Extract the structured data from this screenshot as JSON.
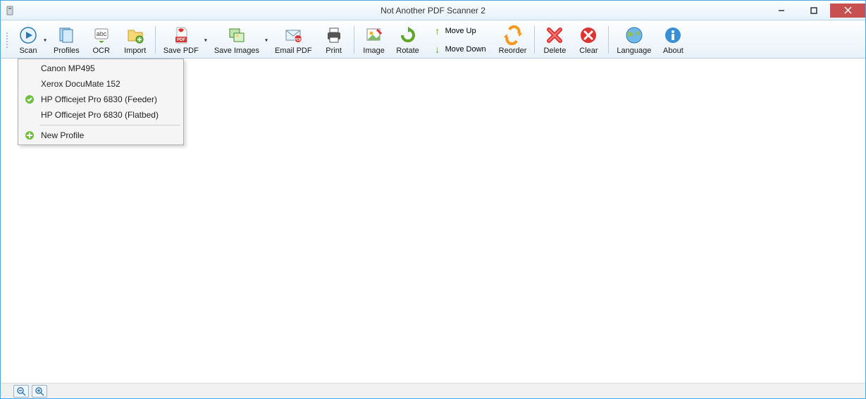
{
  "window": {
    "title": "Not Another PDF Scanner 2"
  },
  "toolbar": {
    "scan": "Scan",
    "profiles": "Profiles",
    "ocr": "OCR",
    "import": "Import",
    "save_pdf": "Save PDF",
    "save_images": "Save Images",
    "email_pdf": "Email PDF",
    "print": "Print",
    "image": "Image",
    "rotate": "Rotate",
    "move_up": "Move Up",
    "move_down": "Move Down",
    "reorder": "Reorder",
    "delete": "Delete",
    "clear": "Clear",
    "language": "Language",
    "about": "About"
  },
  "scan_menu": {
    "items": [
      {
        "label": "Canon MP495",
        "checked": false
      },
      {
        "label": "Xerox DocuMate 152",
        "checked": false
      },
      {
        "label": "HP Officejet Pro 6830 (Feeder)",
        "checked": true
      },
      {
        "label": "HP Officejet Pro 6830 (Flatbed)",
        "checked": false
      }
    ],
    "new_profile": "New Profile"
  }
}
